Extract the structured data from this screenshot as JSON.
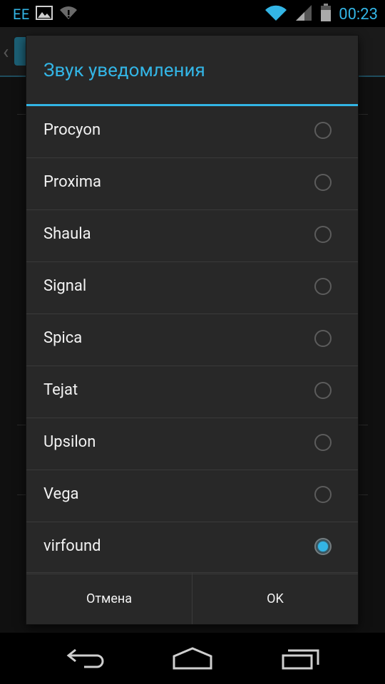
{
  "status_bar": {
    "carrier": "EE",
    "icons": [
      "image-notification-icon",
      "wifi-alert-icon",
      "wifi-icon",
      "signal-icon",
      "battery-icon"
    ],
    "time": "00:23"
  },
  "dialog": {
    "title": "Звук уведомления",
    "items": [
      {
        "label": "Procyon",
        "checked": false
      },
      {
        "label": "Proxima",
        "checked": false
      },
      {
        "label": "Shaula",
        "checked": false
      },
      {
        "label": "Signal",
        "checked": false
      },
      {
        "label": "Spica",
        "checked": false
      },
      {
        "label": "Tejat",
        "checked": false
      },
      {
        "label": "Upsilon",
        "checked": false
      },
      {
        "label": "Vega",
        "checked": false
      },
      {
        "label": "virfound",
        "checked": true
      }
    ],
    "cancel_label": "Отмена",
    "ok_label": "OK"
  },
  "nav_bar": {
    "icons": [
      "back-icon",
      "home-icon",
      "recents-icon"
    ]
  },
  "colors": {
    "accent": "#33b5e5",
    "dialog_bg": "#282828",
    "text": "#f2f2f2"
  }
}
